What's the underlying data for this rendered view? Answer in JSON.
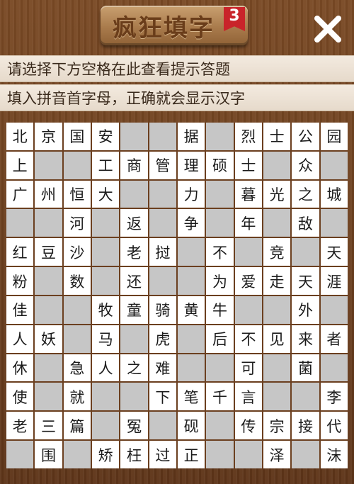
{
  "header": {
    "title": "疯狂填字",
    "level": "3"
  },
  "hints": {
    "line1": "请选择下方空格在此查看提示答题",
    "line2": "填入拼音首字母，正确就会显示汉字"
  },
  "icons": {
    "close": "close-icon"
  },
  "colors": {
    "wood": "#6b3f1f",
    "badge": "#c9242a",
    "cell_empty": "#c6c6c6",
    "cell_filled": "#ffffff"
  },
  "grid": [
    [
      "北",
      "京",
      "国",
      "安",
      "",
      "",
      "据",
      "",
      "烈",
      "士",
      "公",
      "园"
    ],
    [
      "上",
      "",
      "",
      "工",
      "商",
      "管",
      "理",
      "硕",
      "士",
      "",
      "众",
      ""
    ],
    [
      "广",
      "州",
      "恒",
      "大",
      "",
      "",
      "力",
      "",
      "暮",
      "光",
      "之",
      "城"
    ],
    [
      "",
      "",
      "河",
      "",
      "返",
      "",
      "争",
      "",
      "年",
      "",
      "敌",
      ""
    ],
    [
      "红",
      "豆",
      "沙",
      "",
      "老",
      "挝",
      "",
      "不",
      "",
      "竞",
      "",
      "天"
    ],
    [
      "粉",
      "",
      "数",
      "",
      "还",
      "",
      "",
      "为",
      "爱",
      "走",
      "天",
      "涯"
    ],
    [
      "佳",
      "",
      "",
      "牧",
      "童",
      "骑",
      "黄",
      "牛",
      "",
      "",
      "外",
      ""
    ],
    [
      "人",
      "妖",
      "",
      "马",
      "",
      "虎",
      "",
      "后",
      "不",
      "见",
      "来",
      "者"
    ],
    [
      "休",
      "",
      "急",
      "人",
      "之",
      "难",
      "",
      "",
      "可",
      "",
      "菌",
      ""
    ],
    [
      "使",
      "",
      "就",
      "",
      "",
      "下",
      "笔",
      "千",
      "言",
      "",
      "",
      "李"
    ],
    [
      "老",
      "三",
      "篇",
      "",
      "冤",
      "",
      "砚",
      "",
      "传",
      "宗",
      "接",
      "代"
    ],
    [
      "",
      "围",
      "",
      "矫",
      "枉",
      "过",
      "正",
      "",
      "",
      "泽",
      "",
      "沫"
    ]
  ]
}
